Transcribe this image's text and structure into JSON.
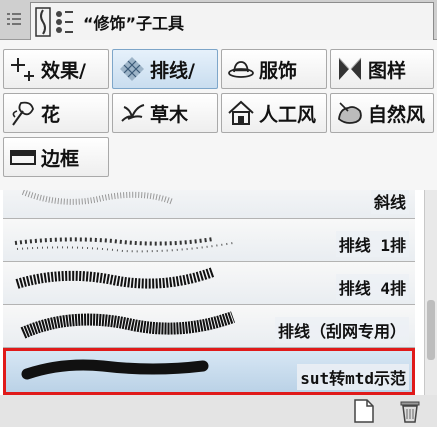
{
  "panel": {
    "title": "“修饰”子工具"
  },
  "categories": [
    {
      "label": "效果/",
      "icon": "sparkle-icon"
    },
    {
      "label": "排线/",
      "icon": "hatching-icon",
      "selected": true
    },
    {
      "label": "服饰",
      "icon": "hat-icon"
    },
    {
      "label": "图样",
      "icon": "pattern-icon"
    },
    {
      "label": "花",
      "icon": "flower-icon"
    },
    {
      "label": "草木",
      "icon": "grass-icon"
    },
    {
      "label": "人工风",
      "icon": "house-icon"
    },
    {
      "label": "自然风",
      "icon": "rock-icon"
    },
    {
      "label": "边框",
      "icon": "border-icon"
    }
  ],
  "brushes": [
    {
      "name": "斜线"
    },
    {
      "name": "排线 1排"
    },
    {
      "name": "排线 4排"
    },
    {
      "name": "排线（刮网专用）"
    },
    {
      "name": "sut转mtd示范",
      "selected": true
    }
  ],
  "colors": {
    "selection_outline": "#e01a1a",
    "selected_bg": "#c9ddef"
  }
}
